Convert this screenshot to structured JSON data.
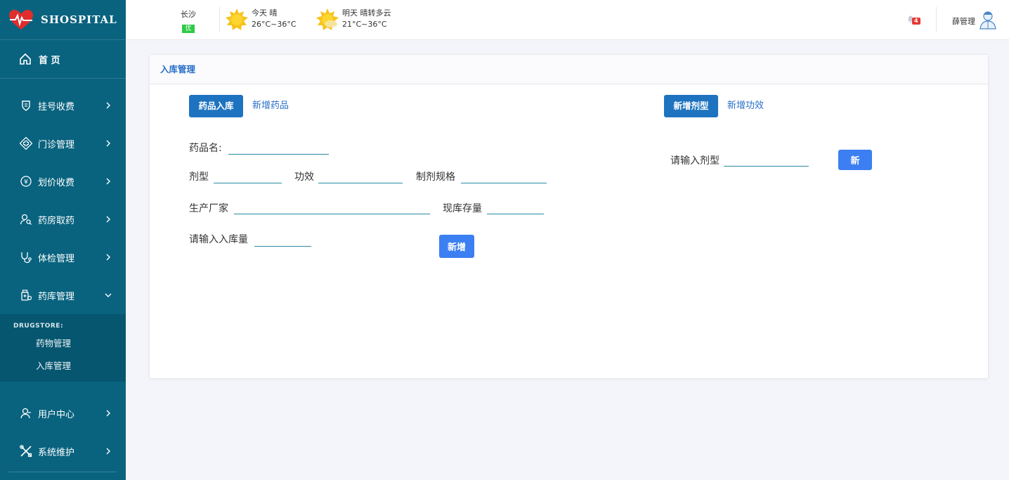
{
  "brand": {
    "name": "SHOSPITAL"
  },
  "sidebar": {
    "home": "首 页",
    "items": [
      {
        "label": "挂号收费",
        "icon": "shield-icon"
      },
      {
        "label": "门诊管理",
        "icon": "medical-cross-icon"
      },
      {
        "label": "划价收费",
        "icon": "yen-icon"
      },
      {
        "label": "药房取药",
        "icon": "user-search-icon"
      },
      {
        "label": "体检管理",
        "icon": "stethoscope-icon"
      },
      {
        "label": "药库管理",
        "icon": "medicine-icon"
      }
    ],
    "submenu": {
      "title": "DRUGSTORE:",
      "items": [
        "药物管理",
        "入库管理"
      ]
    },
    "bottom_items": [
      {
        "label": "用户中心",
        "icon": "user-icon"
      },
      {
        "label": "系统维护",
        "icon": "tools-icon"
      }
    ]
  },
  "header": {
    "city": "长沙",
    "aqi": "优",
    "today": {
      "label": "今天  晴",
      "temp": "26°C~36°C"
    },
    "tomorrow": {
      "label": "明天  晴转多云",
      "temp": "21°C~36°C"
    },
    "notifications": "4",
    "user": "薛管理"
  },
  "card": {
    "title": "入库管理",
    "left_button": "药品入库",
    "left_link": "新增药品",
    "right_button": "新增剂型",
    "right_link": "新增功效",
    "fields": {
      "drug_name": "药品名:",
      "dosage_form": "剂型",
      "efficacy": "功效",
      "spec": "制剂规格",
      "manufacturer": "生产厂家",
      "stock": "现库存量",
      "quantity": "请输入入库量"
    },
    "add_button": "新增",
    "form_label": "请输入剂型",
    "new_button": "新"
  },
  "colors": {
    "sidebar": "#09637f",
    "accent": "#1e73c0",
    "button": "#3b7ff2"
  }
}
